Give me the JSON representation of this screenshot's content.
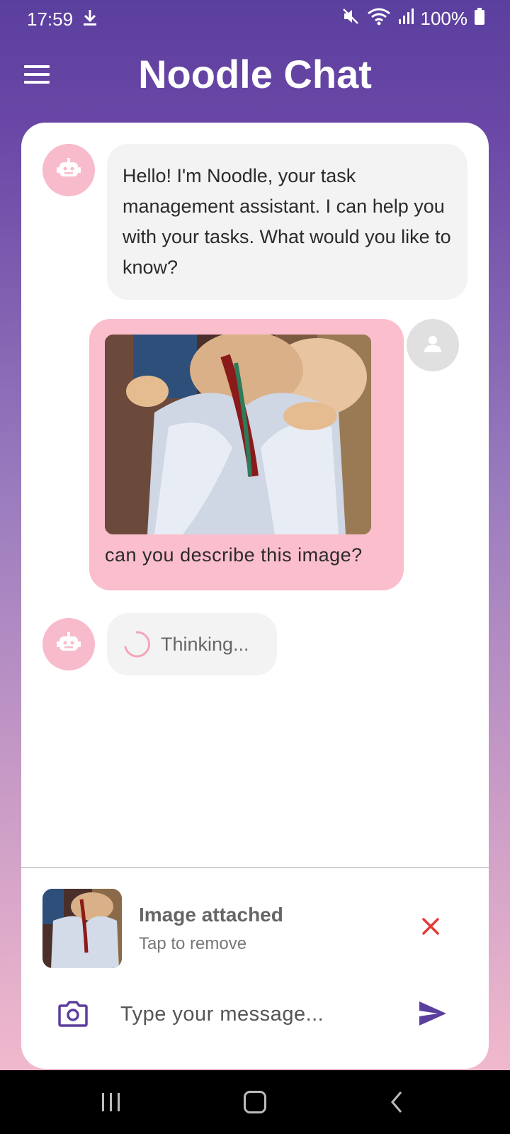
{
  "status_bar": {
    "time": "17:59",
    "battery": "100%"
  },
  "app_bar": {
    "title": "Noodle Chat"
  },
  "messages": [
    {
      "sender": "bot",
      "text": "Hello! I'm Noodle, your task management assistant. I can help you with your tasks. What would you like to know?"
    },
    {
      "sender": "user",
      "has_image": true,
      "text": "can you describe this image?"
    },
    {
      "sender": "bot",
      "text": "Thinking..."
    }
  ],
  "attachment": {
    "title": "Image attached",
    "subtitle": "Tap to remove"
  },
  "composer": {
    "placeholder": "Type your message..."
  },
  "colors": {
    "header": "#5b3f9e",
    "accent": "#5b3f9e",
    "bot_avatar": "#f8bbcb",
    "user_bubble": "#fbbecd",
    "remove": "#e53935"
  }
}
